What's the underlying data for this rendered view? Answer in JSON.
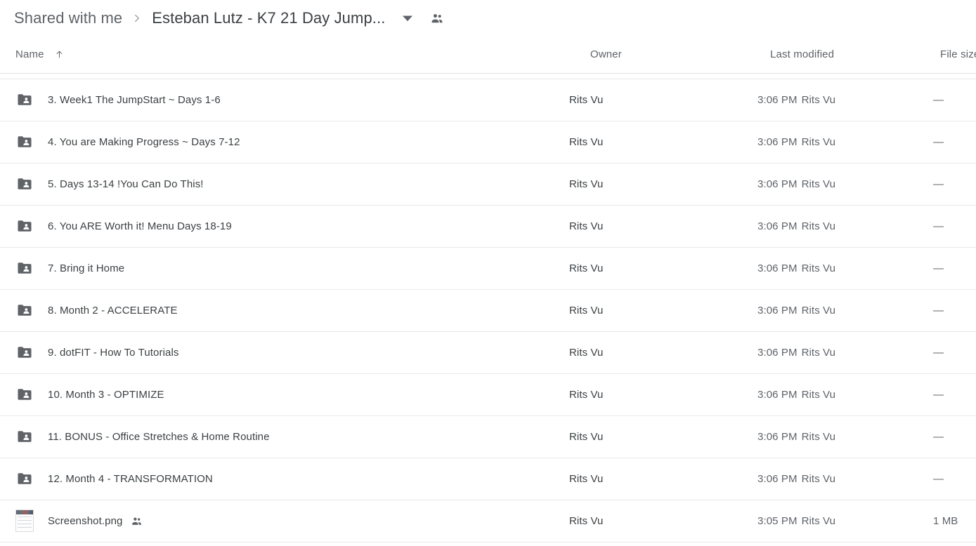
{
  "breadcrumb": {
    "parent": "Shared with me",
    "separator_icon": "chevron-right-icon",
    "current": "Esteban Lutz - K7 21 Day Jump...",
    "caret_icon": "chevron-down-icon",
    "people_icon": "people-shared-icon"
  },
  "table": {
    "columns": {
      "name": "Name",
      "owner": "Owner",
      "modified": "Last modified",
      "size": "File size"
    },
    "sort": {
      "column": "Name",
      "direction": "ascending",
      "icon": "arrow-up-icon"
    },
    "rows": [
      {
        "icon": "shared-folder-icon",
        "type": "folder",
        "name": "3. Week1 The JumpStart ~ Days 1-6",
        "shared": false,
        "owner": "Rits Vu",
        "modified_time": "3:06 PM",
        "modified_by": "Rits Vu",
        "size": "—"
      },
      {
        "icon": "shared-folder-icon",
        "type": "folder",
        "name": "4. You are Making Progress ~ Days 7-12",
        "shared": false,
        "owner": "Rits Vu",
        "modified_time": "3:06 PM",
        "modified_by": "Rits Vu",
        "size": "—"
      },
      {
        "icon": "shared-folder-icon",
        "type": "folder",
        "name": "5. Days 13-14 !You Can Do This!",
        "shared": false,
        "owner": "Rits Vu",
        "modified_time": "3:06 PM",
        "modified_by": "Rits Vu",
        "size": "—"
      },
      {
        "icon": "shared-folder-icon",
        "type": "folder",
        "name": "6. You ARE Worth it! Menu Days 18-19",
        "shared": false,
        "owner": "Rits Vu",
        "modified_time": "3:06 PM",
        "modified_by": "Rits Vu",
        "size": "—"
      },
      {
        "icon": "shared-folder-icon",
        "type": "folder",
        "name": "7. Bring it Home",
        "shared": false,
        "owner": "Rits Vu",
        "modified_time": "3:06 PM",
        "modified_by": "Rits Vu",
        "size": "—"
      },
      {
        "icon": "shared-folder-icon",
        "type": "folder",
        "name": "8. Month 2 - ACCELERATE",
        "shared": false,
        "owner": "Rits Vu",
        "modified_time": "3:06 PM",
        "modified_by": "Rits Vu",
        "size": "—"
      },
      {
        "icon": "shared-folder-icon",
        "type": "folder",
        "name": "9. dotFIT - How To Tutorials",
        "shared": false,
        "owner": "Rits Vu",
        "modified_time": "3:06 PM",
        "modified_by": "Rits Vu",
        "size": "—"
      },
      {
        "icon": "shared-folder-icon",
        "type": "folder",
        "name": "10. Month 3 - OPTIMIZE",
        "shared": false,
        "owner": "Rits Vu",
        "modified_time": "3:06 PM",
        "modified_by": "Rits Vu",
        "size": "—"
      },
      {
        "icon": "shared-folder-icon",
        "type": "folder",
        "name": "11. BONUS - Office Stretches & Home Routine",
        "shared": false,
        "owner": "Rits Vu",
        "modified_time": "3:06 PM",
        "modified_by": "Rits Vu",
        "size": "—"
      },
      {
        "icon": "shared-folder-icon",
        "type": "folder",
        "name": "12. Month 4 - TRANSFORMATION",
        "shared": false,
        "owner": "Rits Vu",
        "modified_time": "3:06 PM",
        "modified_by": "Rits Vu",
        "size": "—"
      },
      {
        "icon": "image-thumbnail-icon",
        "type": "image",
        "name": "Screenshot.png",
        "shared": true,
        "owner": "Rits Vu",
        "modified_time": "3:05 PM",
        "modified_by": "Rits Vu",
        "size": "1 MB"
      }
    ]
  },
  "colors": {
    "text_primary": "#3c4043",
    "text_secondary": "#5f6368",
    "divider": "#e8eaed",
    "folder_icon": "#5f6368",
    "background": "#ffffff"
  }
}
